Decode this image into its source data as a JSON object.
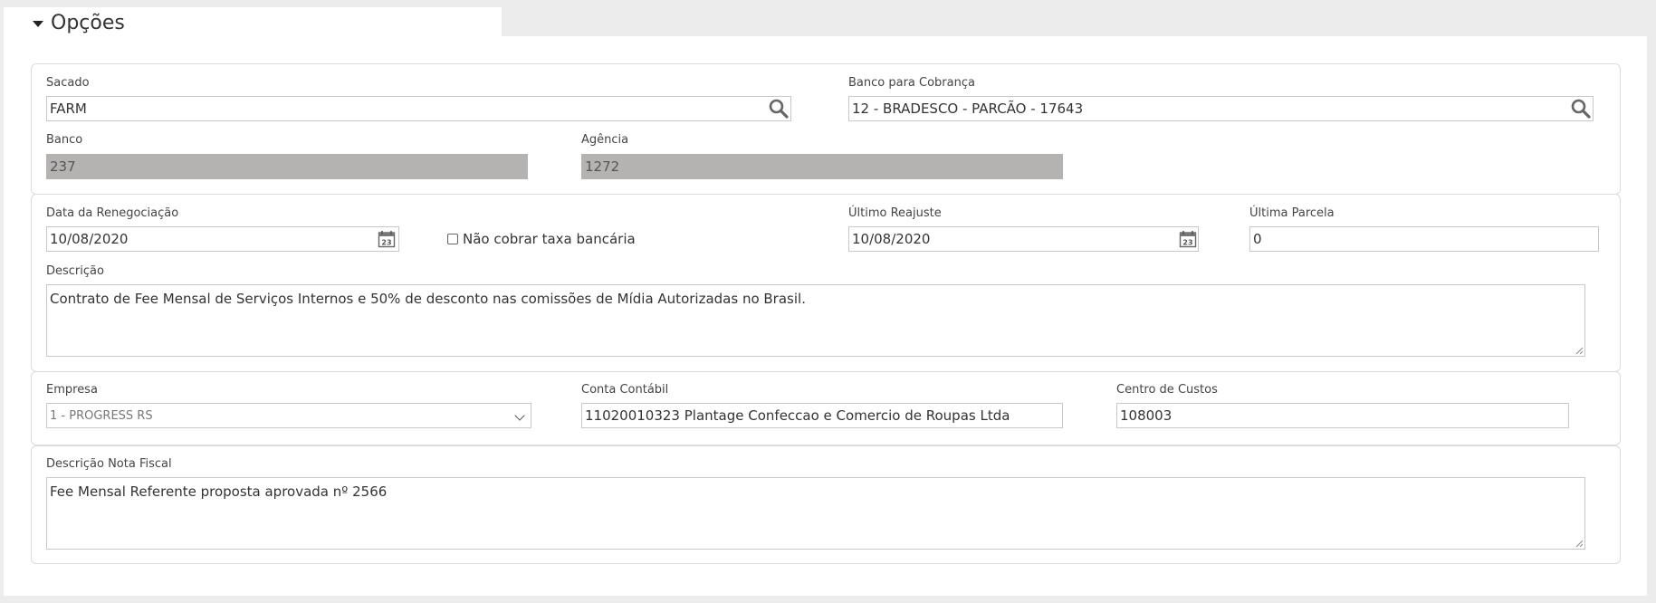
{
  "section": {
    "title": "Opções"
  },
  "cobranca": {
    "sacado_label": "Sacado",
    "sacado_value": "FARM",
    "banco_cobranca_label": "Banco para Cobrança",
    "banco_cobranca_value": "12 - BRADESCO - PARCÃO - 17643",
    "banco_label": "Banco",
    "banco_value": "237",
    "agencia_label": "Agência",
    "agencia_value": "1272"
  },
  "renegociacao": {
    "data_label": "Data da Renegociação",
    "data_value": "10/08/2020",
    "nao_cobrar_label": "Não cobrar taxa bancária",
    "nao_cobrar_checked": false,
    "ultimo_reajuste_label": "Último Reajuste",
    "ultimo_reajuste_value": "10/08/2020",
    "ultima_parcela_label": "Última Parcela",
    "ultima_parcela_value": "0",
    "descricao_label": "Descrição",
    "descricao_value": "Contrato de Fee Mensal de Serviços Internos e 50% de desconto nas comissões de Mídia Autorizadas no Brasil."
  },
  "contabil": {
    "empresa_label": "Empresa",
    "empresa_value": "1 - PROGRESS RS",
    "conta_label": "Conta Contábil",
    "conta_value": "11020010323 Plantage Confeccao e Comercio de Roupas Ltda",
    "centro_label": "Centro de Custos",
    "centro_value": "108003"
  },
  "nota_fiscal": {
    "descricao_label": "Descrição Nota Fiscal",
    "descricao_value": "Fee Mensal Referente proposta aprovada nº 2566"
  },
  "icons": {
    "search": "search-icon",
    "calendar": "calendar-icon",
    "caret": "caret-down-icon",
    "select_chevron": "chevron-down-icon"
  },
  "colors": {
    "disabled_field": "#b5b2b2",
    "background": "#ececec",
    "border": "#dcdcdc"
  }
}
